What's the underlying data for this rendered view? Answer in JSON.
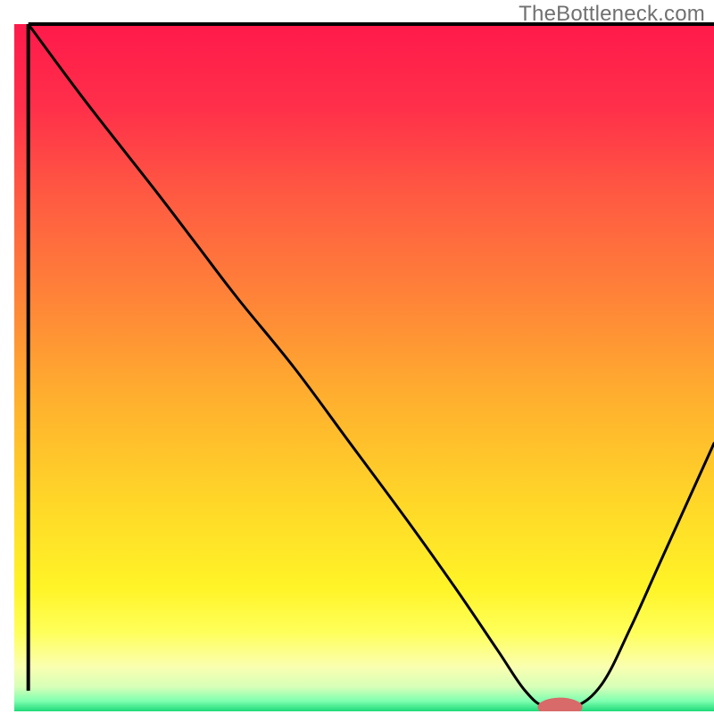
{
  "watermark": "TheBottleneck.com",
  "chart_data": {
    "type": "line",
    "title": "",
    "xlabel": "",
    "ylabel": "",
    "xlim": [
      0,
      100
    ],
    "ylim": [
      0,
      100
    ],
    "legend": false,
    "grid": false,
    "background_gradient_stops": [
      {
        "offset": 0.0,
        "color": "#ff1a4b"
      },
      {
        "offset": 0.12,
        "color": "#ff2f4a"
      },
      {
        "offset": 0.25,
        "color": "#ff5a42"
      },
      {
        "offset": 0.4,
        "color": "#ff8438"
      },
      {
        "offset": 0.55,
        "color": "#ffb12e"
      },
      {
        "offset": 0.7,
        "color": "#ffd828"
      },
      {
        "offset": 0.82,
        "color": "#fff427"
      },
      {
        "offset": 0.885,
        "color": "#ffff5a"
      },
      {
        "offset": 0.935,
        "color": "#faffb0"
      },
      {
        "offset": 0.965,
        "color": "#d6ffb8"
      },
      {
        "offset": 0.985,
        "color": "#7fffb0"
      },
      {
        "offset": 1.0,
        "color": "#1fd97a"
      }
    ],
    "series": [
      {
        "name": "bottleneck-curve",
        "color": "#000000",
        "x": [
          2,
          10,
          20,
          26,
          32,
          40,
          48,
          56,
          63,
          69,
          73,
          76,
          80,
          84,
          88,
          92,
          96,
          100
        ],
        "values": [
          100,
          89,
          76,
          68,
          60,
          50,
          39,
          28,
          18,
          9,
          3,
          0.6,
          0.6,
          4,
          12,
          21,
          30,
          39
        ]
      }
    ],
    "marker": {
      "name": "optimal-marker",
      "color": "#d86a6a",
      "x": 78,
      "y": 0.6,
      "rx": 3.2,
      "ry": 1.0
    },
    "axes": {
      "left": {
        "x": 2,
        "y1": 3,
        "y2": 100
      },
      "bottom": {
        "y": 100,
        "x1": 2,
        "x2": 100
      }
    }
  }
}
